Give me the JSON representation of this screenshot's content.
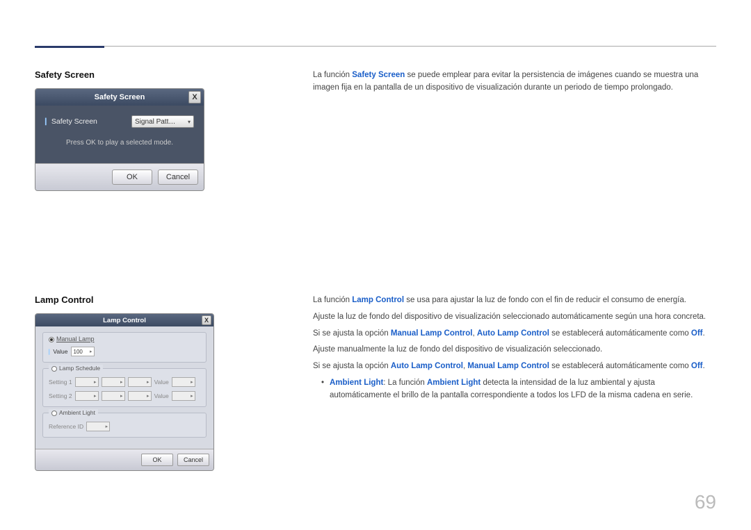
{
  "page_number": "69",
  "sections": [
    {
      "heading": "Safety Screen",
      "dialog": {
        "title": "Safety Screen",
        "close": "X",
        "field_label": "Safety Screen",
        "field_value": "Signal Patt…",
        "hint": "Press OK to play a selected mode.",
        "ok": "OK",
        "cancel": "Cancel"
      },
      "desc": {
        "p1_pre": "La función ",
        "p1_b": "Safety Screen",
        "p1_post": " se puede emplear para evitar la persistencia de imágenes cuando se muestra una imagen fija en la pantalla de un dispositivo de visualización durante un periodo de tiempo prolongado."
      }
    },
    {
      "heading": "Lamp Control",
      "dialog": {
        "title": "Lamp Control",
        "close": "X",
        "grp_manual": "Manual Lamp",
        "lab_value": "Value",
        "val_value": "100",
        "grp_sched": "Lamp Schedule",
        "lab_set1": "Setting 1",
        "lab_set2": "Setting 2",
        "lab_sval": "Value",
        "grp_amb": "Ambient Light",
        "lab_ref": "Reference ID",
        "ok": "OK",
        "cancel": "Cancel"
      },
      "desc": {
        "p1_pre": "La función ",
        "p1_b": "Lamp Control",
        "p1_post": " se usa para ajustar la luz de fondo con el fin de reducir el consumo de energía.",
        "p2": "Ajuste la luz de fondo del dispositivo de visualización seleccionado automáticamente según una hora concreta.",
        "p3_pre": "Si se ajusta la opción ",
        "p3_b1": "Manual Lamp Control",
        "p3_mid": ", ",
        "p3_b2": "Auto Lamp Control",
        "p3_post1": " se establecerá automáticamente como ",
        "p3_b3": "Off",
        "p3_post2": ".",
        "p4": "Ajuste manualmente la luz de fondo del dispositivo de visualización seleccionado.",
        "p5_pre": "Si se ajusta la opción ",
        "p5_b1": "Auto Lamp Control",
        "p5_mid": ", ",
        "p5_b2": "Manual Lamp Control",
        "p5_post1": " se establecerá automáticamente como ",
        "p5_b3": "Off",
        "p5_post2": ".",
        "bul_b1": "Ambient Light",
        "bul_mid": ": La función ",
        "bul_b2": "Ambient Light",
        "bul_post": " detecta la intensidad de la luz ambiental y ajusta automáticamente el brillo de la pantalla correspondiente a todos los LFD de la misma cadena en serie."
      }
    }
  ]
}
